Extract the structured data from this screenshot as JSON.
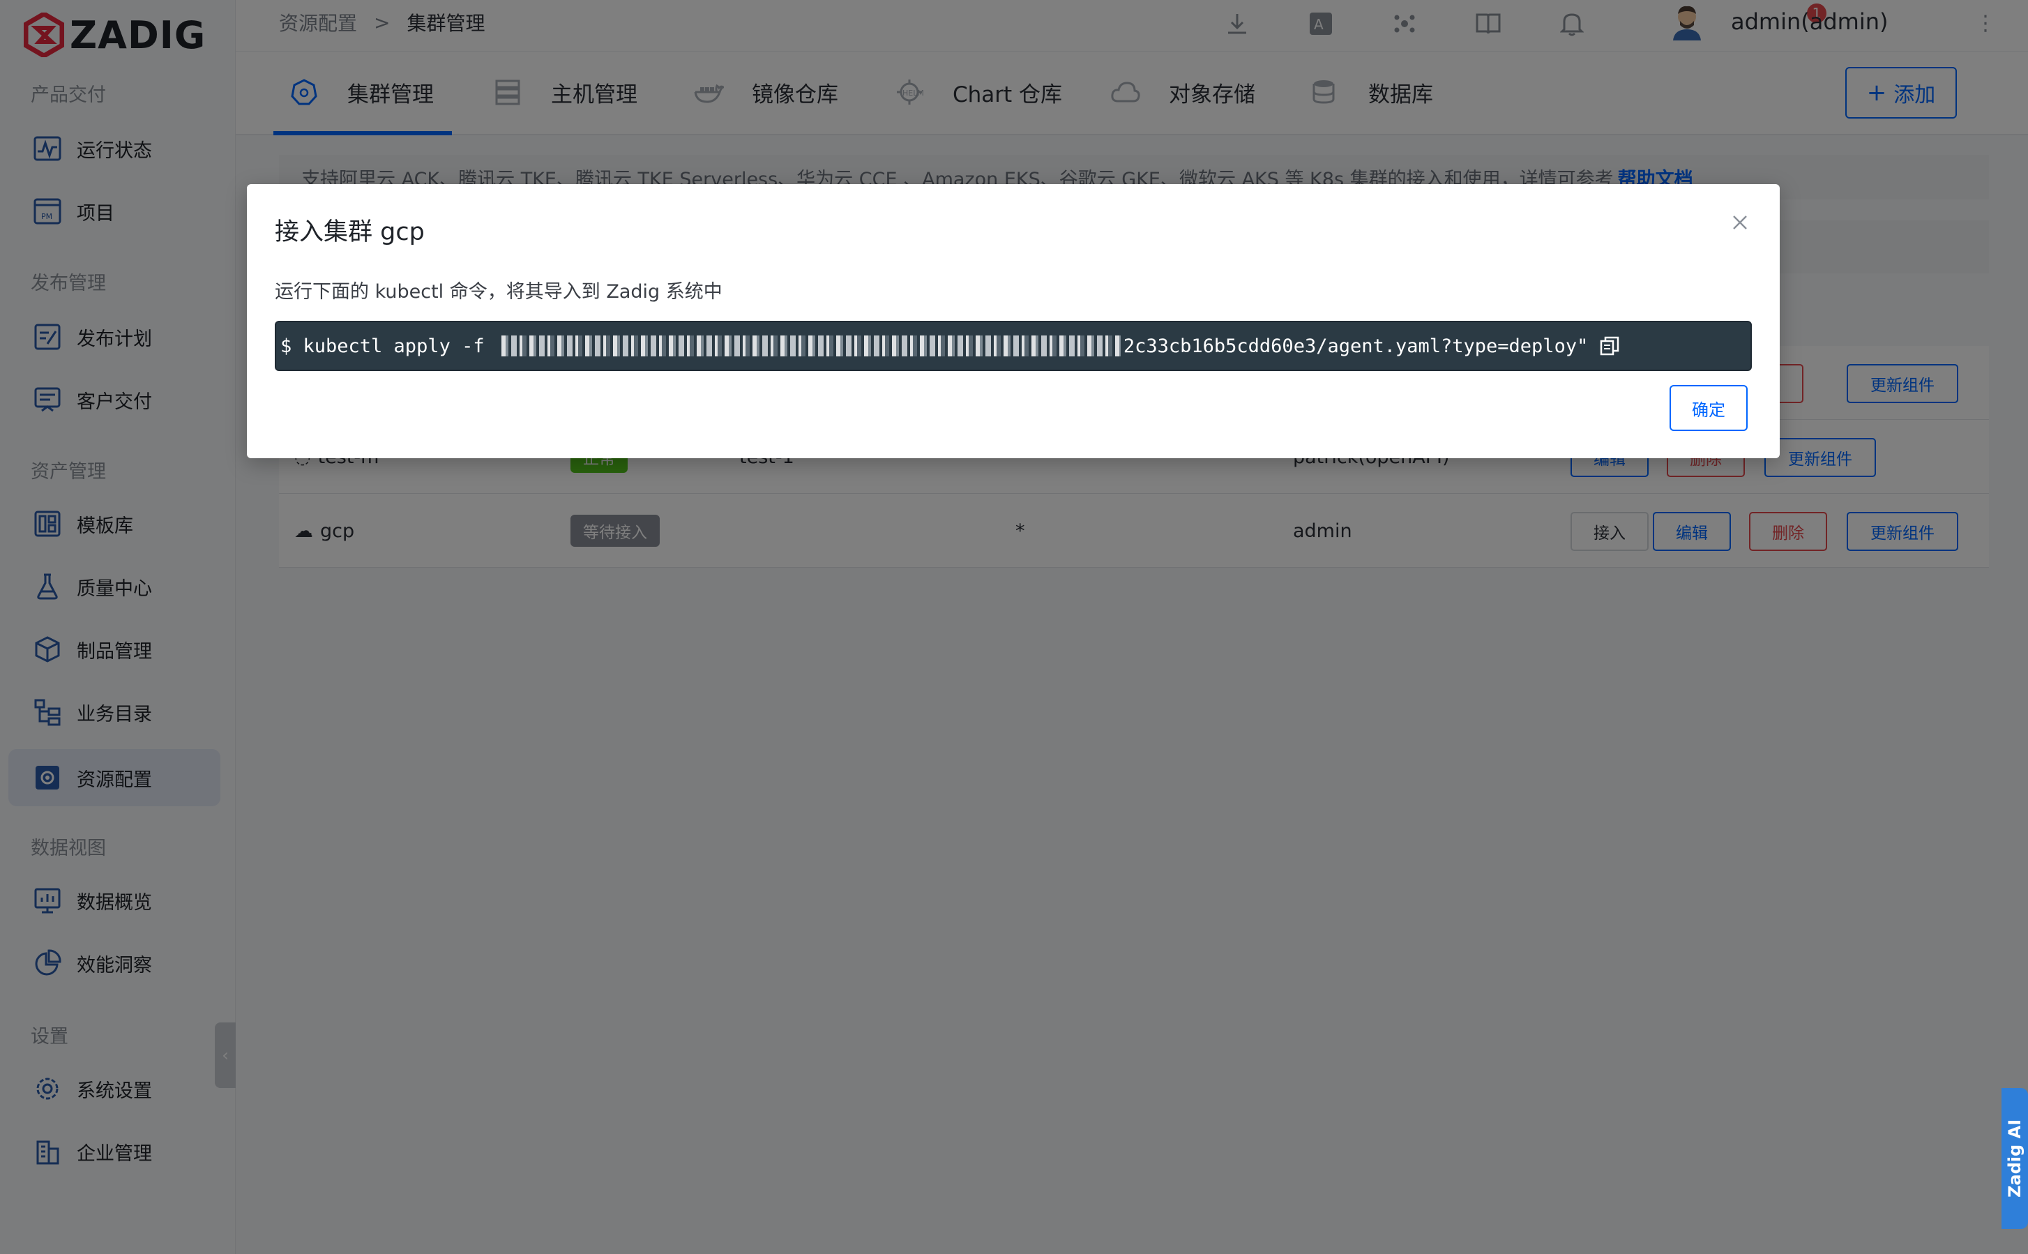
{
  "brand": {
    "name": "ZADIG",
    "accent": "#0066ff",
    "logo_color": "#e8283e"
  },
  "sidebar": {
    "groups": [
      {
        "title": "产品交付",
        "items": [
          {
            "label": "运行状态",
            "icon": "activity-icon"
          },
          {
            "label": "项目",
            "icon": "project-pm-icon"
          }
        ]
      },
      {
        "title": "发布管理",
        "items": [
          {
            "label": "发布计划",
            "icon": "release-plan-icon"
          },
          {
            "label": "客户交付",
            "icon": "customer-delivery-icon"
          }
        ]
      },
      {
        "title": "资产管理",
        "items": [
          {
            "label": "模板库",
            "icon": "template-icon"
          },
          {
            "label": "质量中心",
            "icon": "flask-icon"
          },
          {
            "label": "制品管理",
            "icon": "package-icon"
          },
          {
            "label": "业务目录",
            "icon": "catalog-icon"
          },
          {
            "label": "资源配置",
            "icon": "resource-gear-icon",
            "active": true
          }
        ]
      },
      {
        "title": "数据视图",
        "items": [
          {
            "label": "数据概览",
            "icon": "dashboard-icon"
          },
          {
            "label": "效能洞察",
            "icon": "pie-chart-icon"
          }
        ]
      },
      {
        "title": "设置",
        "items": [
          {
            "label": "系统设置",
            "icon": "settings-icon"
          },
          {
            "label": "企业管理",
            "icon": "enterprise-icon"
          }
        ]
      }
    ]
  },
  "topbar": {
    "breadcrumb": [
      "资源配置",
      ">",
      "集群管理"
    ],
    "notification_count": "1",
    "user": "admin(admin)"
  },
  "tabs": [
    {
      "label": "集群管理",
      "icon": "kubernetes-icon",
      "active": true
    },
    {
      "label": "主机管理",
      "icon": "server-icon"
    },
    {
      "label": "镜像仓库",
      "icon": "docker-icon"
    },
    {
      "label": "Chart 仓库",
      "icon": "helm-icon"
    },
    {
      "label": "对象存储",
      "icon": "cloud-icon"
    },
    {
      "label": "数据库",
      "icon": "database-icon"
    }
  ],
  "add_button": "添加",
  "notice": {
    "text": "支持阿里云 ACK、腾讯云 TKE、腾讯云 TKE Serverless、华为云 CCE 、Amazon EKS、谷歌云 GKE、微软云 AKS 等 K8s 集群的接入和使用，详情可参考",
    "link": "帮助文档"
  },
  "table": {
    "rows": [
      {
        "name": "",
        "status": "",
        "namespace": "",
        "creator": "",
        "buttons": [
          "删除",
          "更新组件"
        ]
      },
      {
        "name": "test-m",
        "status": "正常",
        "namespace": "test-1",
        "creator": "patrick(openAPI)",
        "buttons": [
          "编辑",
          "删除",
          "更新组件"
        ]
      },
      {
        "name": "gcp",
        "status": "等待接入",
        "namespace": "*",
        "creator": "admin",
        "buttons": [
          "接入",
          "编辑",
          "删除",
          "更新组件"
        ]
      }
    ]
  },
  "modal": {
    "title": "接入集群 gcp",
    "description": "运行下面的 kubectl 命令，将其导入到 Zadig 系统中",
    "command_prefix": "$ kubectl apply -f ",
    "command_suffix": "2c33cb16b5cdd60e3/agent.yaml?type=deploy\"",
    "confirm": "确定"
  },
  "ai_assistant": "Zadig AI"
}
